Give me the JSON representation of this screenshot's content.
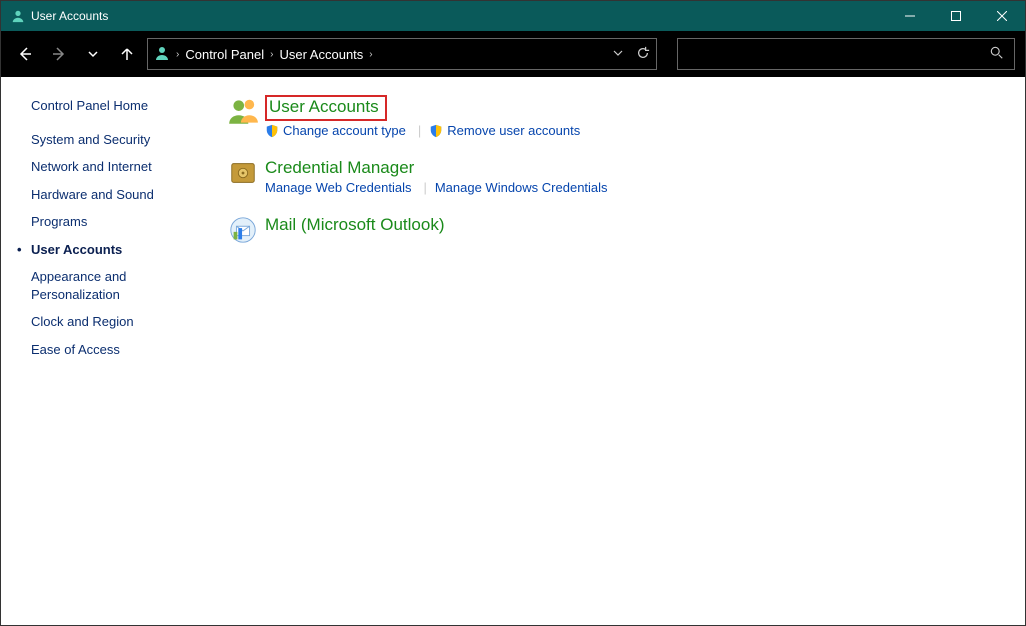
{
  "window": {
    "title": "User Accounts"
  },
  "breadcrumb": {
    "root": "Control Panel",
    "current": "User Accounts"
  },
  "sidebar": {
    "items": [
      {
        "label": "Control Panel Home",
        "active": false
      },
      {
        "label": "System and Security",
        "active": false
      },
      {
        "label": "Network and Internet",
        "active": false
      },
      {
        "label": "Hardware and Sound",
        "active": false
      },
      {
        "label": "Programs",
        "active": false
      },
      {
        "label": "User Accounts",
        "active": true
      },
      {
        "label": "Appearance and Personalization",
        "active": false
      },
      {
        "label": "Clock and Region",
        "active": false
      },
      {
        "label": "Ease of Access",
        "active": false
      }
    ]
  },
  "categories": [
    {
      "title": "User Accounts",
      "highlight": true,
      "icon": "people-icon",
      "links": [
        {
          "label": "Change account type",
          "shield": true
        },
        {
          "label": "Remove user accounts",
          "shield": true
        }
      ]
    },
    {
      "title": "Credential Manager",
      "highlight": false,
      "icon": "vault-icon",
      "links": [
        {
          "label": "Manage Web Credentials",
          "shield": false
        },
        {
          "label": "Manage Windows Credentials",
          "shield": false
        }
      ]
    },
    {
      "title": "Mail (Microsoft Outlook)",
      "highlight": false,
      "icon": "mail-icon",
      "links": []
    }
  ]
}
